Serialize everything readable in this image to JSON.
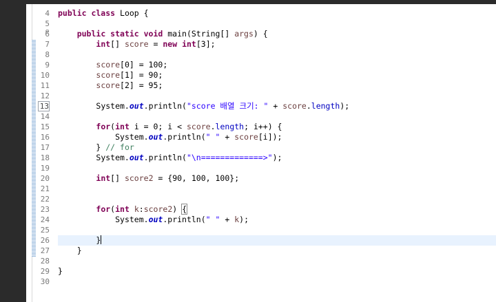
{
  "editor": {
    "line_numbers": [
      "4",
      "5",
      "6",
      "7",
      "8",
      "9",
      "10",
      "11",
      "12",
      "13",
      "14",
      "15",
      "16",
      "17",
      "18",
      "19",
      "20",
      "21",
      "22",
      "23",
      "24",
      "25",
      "26",
      "27",
      "28",
      "29",
      "30"
    ],
    "code": {
      "l4": {
        "kw": "public class",
        "rest": " Loop {"
      },
      "l6": {
        "kw1": "public static void",
        "rest": " main(String[] ",
        "param": "args",
        "end": ") {"
      },
      "l7": {
        "kw1": "int",
        "mid": "[] ",
        "var": "score",
        "eq": " = ",
        "kw2": "new",
        "sp": " ",
        "kw3": "int",
        "end": "[3];"
      },
      "l9": {
        "var": "score",
        "rest": "[0] = 100;"
      },
      "l10": {
        "var": "score",
        "rest": "[1] = 90;"
      },
      "l11": {
        "var": "score",
        "rest": "[2] = 95;"
      },
      "l13": {
        "pre": "System.",
        "out": "out",
        "mid": ".println(",
        "str": "\"score 배열 크기: \"",
        "plus": " + ",
        "var": "score",
        "dot": ".",
        "fld": "length",
        "end": ");"
      },
      "l15": {
        "kw": "for",
        "p1": "(",
        "kw2": "int",
        "p2": " i = 0; i < ",
        "var": "score",
        "dot": ".",
        "fld": "length",
        "p3": "; i++) {"
      },
      "l16": {
        "pre": "System.",
        "out": "out",
        "mid": ".println(",
        "str": "\" \"",
        "plus": " + ",
        "var": "score",
        "end": "[i]);"
      },
      "l17": {
        "brace": "} ",
        "cmt": "// for"
      },
      "l18": {
        "pre": "System.",
        "out": "out",
        "mid": ".println(",
        "str": "\"\\n=============>\"",
        "end": ");"
      },
      "l20": {
        "kw": "int",
        "mid": "[] ",
        "var": "score2",
        "end": " = {90, 100, 100};"
      },
      "l23": {
        "kw": "for",
        "p1": "(",
        "kw2": "int",
        "sp": " ",
        "var": "k",
        "colon": ":",
        "var2": "score2",
        "end": ") ",
        "brace": "{"
      },
      "l24": {
        "pre": "System.",
        "out": "out",
        "mid": ".println(",
        "str": "\" \"",
        "plus": " + ",
        "var": "k",
        "end": ");"
      },
      "l26": {
        "brace": "}"
      },
      "l27": {
        "brace": "}"
      },
      "l29": {
        "brace": "}"
      }
    }
  },
  "colors": {
    "keyword": "#7f0055",
    "string": "#2a00ff",
    "field": "#0000c0",
    "comment": "#3f7f5f",
    "current_line": "#e8f2fe"
  }
}
